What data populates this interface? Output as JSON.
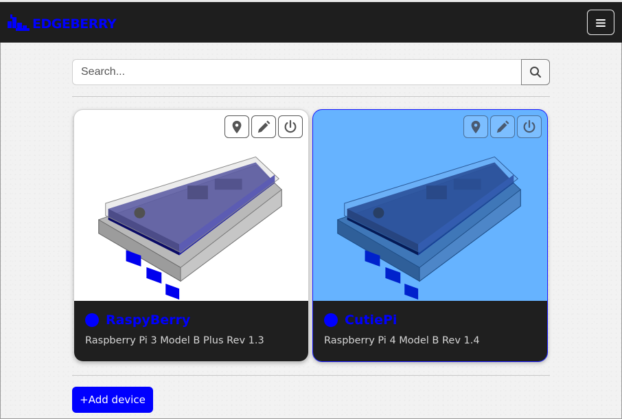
{
  "brand": {
    "name": "EDGEBERRY",
    "color": "#0000ff"
  },
  "navbar": {
    "menu_icon": "hamburger-icon"
  },
  "search": {
    "placeholder": "Search...",
    "value": "",
    "icon": "search-icon"
  },
  "devices": [
    {
      "name": "RaspyBerry",
      "model": "Raspberry Pi 3 Model B Plus Rev 1.3",
      "status_color": "#0000ff",
      "card_background": "#ffffff",
      "actions": [
        "location-icon",
        "pencil-icon",
        "power-icon"
      ]
    },
    {
      "name": "CutiePi",
      "model": "Raspberry Pi 4 Model B Rev 1.4",
      "status_color": "#0000ff",
      "card_background": "#66b3ff",
      "actions": [
        "location-icon",
        "pencil-icon",
        "power-icon"
      ]
    }
  ],
  "add_device": {
    "label": "+Add device"
  }
}
